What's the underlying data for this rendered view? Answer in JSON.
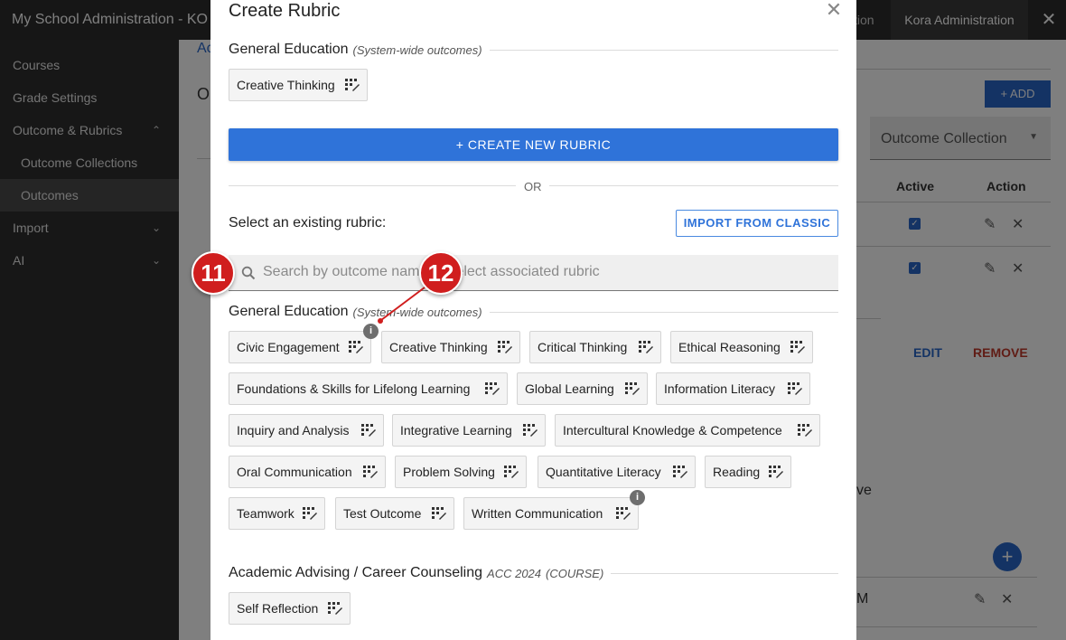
{
  "app": {
    "title": "My School Administration - KO",
    "top_partial": "tion",
    "top_admin": "Kora Administration",
    "close_glyph": "✕"
  },
  "sidebar": {
    "items": [
      {
        "label": "Courses",
        "chevron": ""
      },
      {
        "label": "Grade Settings",
        "chevron": ""
      },
      {
        "label": "Outcome & Rubrics",
        "chevron": "⌃"
      },
      {
        "label": "Outcome Collections",
        "chevron": ""
      },
      {
        "label": "Outcomes",
        "chevron": ""
      },
      {
        "label": "Import",
        "chevron": "⌄"
      },
      {
        "label": "AI",
        "chevron": "⌄"
      }
    ]
  },
  "background": {
    "add_label": "+ ADD",
    "select_label": "Outcome Collection",
    "col_active": "Active",
    "col_action": "Action",
    "edit_label": "EDIT",
    "remove_label": "REMOVE",
    "frag_a": "Ac",
    "frag_o": "O",
    "frag_ve": "ve",
    "frag_m": "M"
  },
  "modal": {
    "title": "Create Rubric",
    "close_glyph": "✕",
    "top_section": {
      "name": "General Education",
      "sub": "(System-wide outcomes)"
    },
    "top_chips": [
      "Creative Thinking"
    ],
    "create_button": "+  CREATE NEW RUBRIC",
    "or_text": "OR",
    "select_label": "Select an existing rubric:",
    "import_button": "IMPORT FROM CLASSIC",
    "search_placeholder": "Search by outcome name or select associated rubric",
    "gen_ed_section": {
      "name": "General Education",
      "sub": "(System-wide outcomes)"
    },
    "gen_ed_chips": [
      "Civic Engagement",
      "Creative Thinking",
      "Critical Thinking",
      "Ethical Reasoning",
      "Foundations & Skills for Lifelong Learning",
      "Global Learning",
      "Information Literacy",
      "Inquiry and Analysis",
      "Integrative Learning",
      "Intercultural Knowledge & Competence",
      "Oral Communication",
      "Problem Solving",
      "Quantitative Literacy",
      "Reading",
      "Teamwork",
      "Test Outcome",
      "Written Communication"
    ],
    "advising_section": {
      "name": "Academic Advising / Career Counseling",
      "code": "ACC 2024",
      "sub": "(COURSE)"
    },
    "advising_chips": [
      "Self Reflection"
    ]
  },
  "callouts": [
    "11",
    "12"
  ],
  "colors": {
    "primary": "#2f73d9",
    "callout": "#d01e1e",
    "remove": "#c0392b"
  },
  "icons": {
    "rubric": "rubric-grid-icon",
    "search": "search-icon",
    "info": "info-icon"
  }
}
